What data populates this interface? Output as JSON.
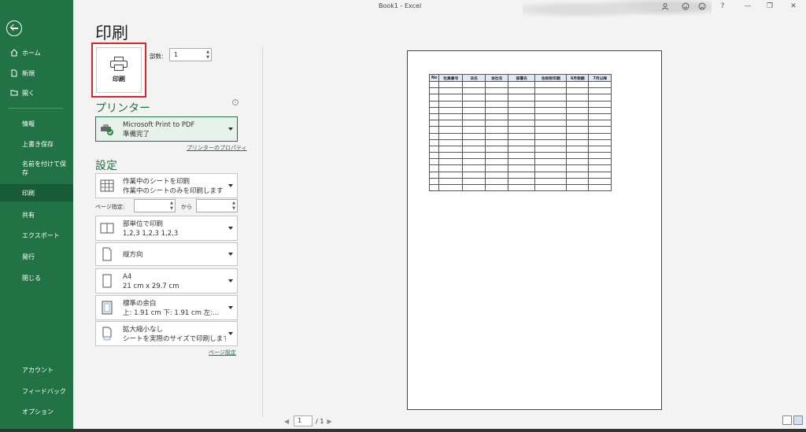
{
  "window": {
    "title": "Book1  -  Excel",
    "help": "?",
    "minimize": "—",
    "restore": "❐",
    "close": "✕"
  },
  "sidebar": {
    "home": "ホーム",
    "new": "新規",
    "open": "開く",
    "info": "情報",
    "save": "上書き保存",
    "save_as": "名前を付けて保存",
    "print": "印刷",
    "share": "共有",
    "export": "エクスポート",
    "publish": "発行",
    "close": "閉じる",
    "account": "アカウント",
    "feedback": "フィードバック",
    "options": "オプション"
  },
  "page": {
    "title": "印刷",
    "print_button": "印刷",
    "copies_label": "部数:",
    "copies_value": "1"
  },
  "printer": {
    "section_title": "プリンター",
    "info": "i",
    "name": "Microsoft Print to PDF",
    "status": "準備完了",
    "properties_link": "プリンターのプロパティ"
  },
  "settings": {
    "section_title": "設定",
    "what": {
      "line1": "作業中のシートを印刷",
      "line2": "作業中のシートのみを印刷します"
    },
    "pages_label": "ページ指定:",
    "pages_to": "から",
    "collate": {
      "line1": "部単位で印刷",
      "line2": "1,2,3    1,2,3    1,2,3"
    },
    "orientation": {
      "line1": "縦方向"
    },
    "paper": {
      "line1": "A4",
      "line2": "21 cm x 29.7 cm"
    },
    "margins": {
      "line1": "標準の余白",
      "line2": "上: 1.91 cm 下: 1.91 cm 左:..."
    },
    "scaling": {
      "line1": "拡大縮小なし",
      "line2": "シートを実際のサイズで印刷します"
    },
    "page_setup_link": "ページ設定"
  },
  "preview": {
    "headers": [
      "No",
      "社員番号",
      "氏名",
      "会社名",
      "部署名",
      "住民税年額",
      "6月税額",
      "7月以降"
    ],
    "empty_rows": 17
  },
  "pager": {
    "current": "1",
    "total": "/ 1"
  },
  "colors": {
    "accent": "#217346",
    "highlight": "#d8262f"
  }
}
